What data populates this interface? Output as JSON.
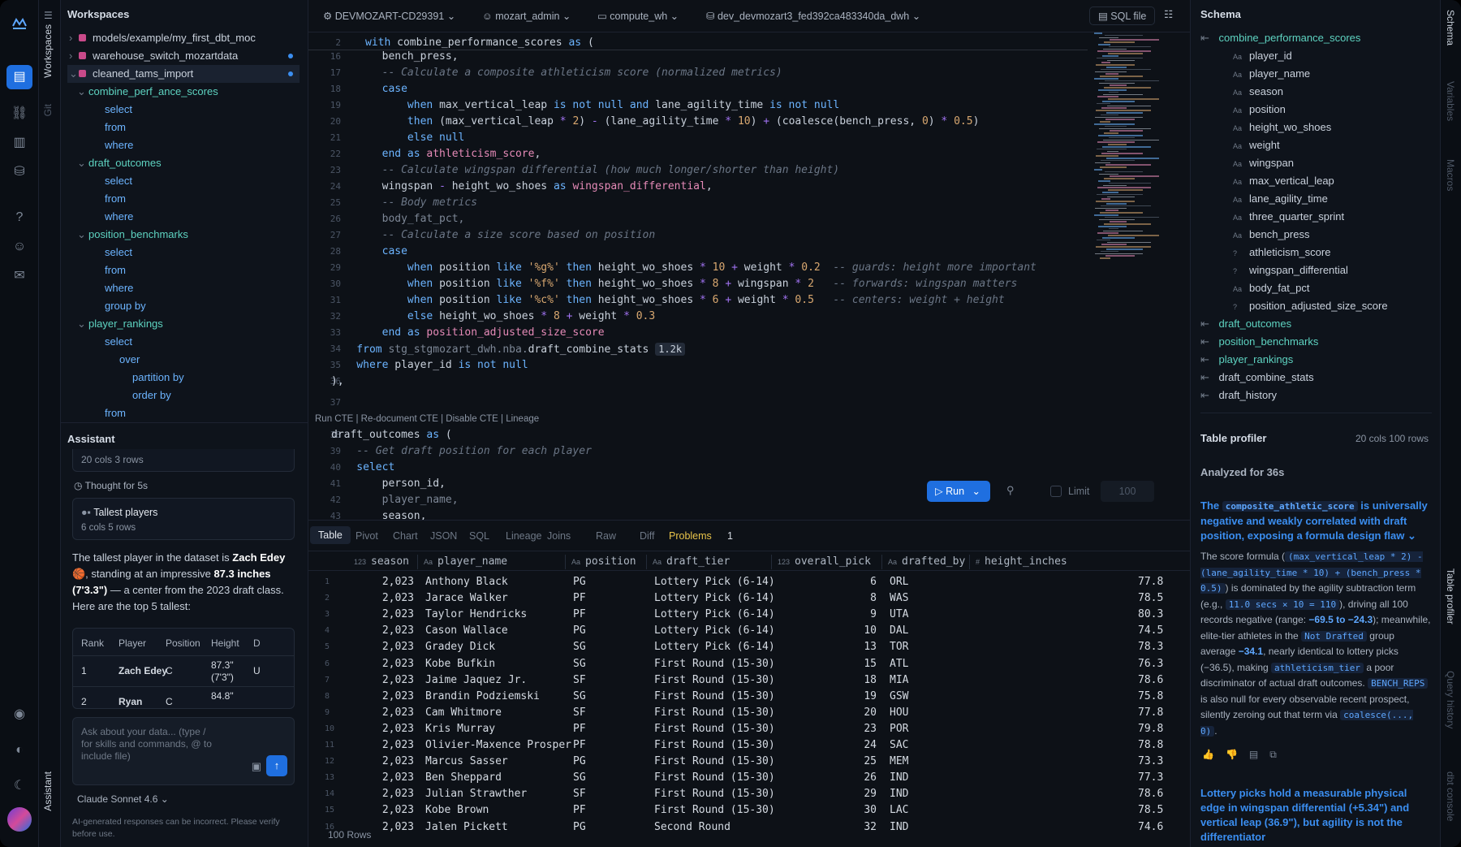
{
  "workspaces": {
    "title": "Workspaces",
    "files": [
      {
        "name": "models/example/my_first_dbt_moc",
        "dot": false
      },
      {
        "name": "warehouse_switch_mozartdata",
        "dot": true
      },
      {
        "name": "cleaned_tams_import",
        "dot": true
      }
    ],
    "outline": [
      {
        "label": "combine_perf_ance_scores",
        "kind": "cte",
        "indent": 0
      },
      {
        "label": "select",
        "kind": "kw",
        "indent": 1
      },
      {
        "label": "from",
        "kind": "kw",
        "indent": 1
      },
      {
        "label": "where",
        "kind": "kw",
        "indent": 1
      },
      {
        "label": "draft_outcomes",
        "kind": "cte",
        "indent": 0
      },
      {
        "label": "select",
        "kind": "kw",
        "indent": 1
      },
      {
        "label": "from",
        "kind": "kw",
        "indent": 1
      },
      {
        "label": "where",
        "kind": "kw",
        "indent": 1
      },
      {
        "label": "position_benchmarks",
        "kind": "cte",
        "indent": 0
      },
      {
        "label": "select",
        "kind": "kw",
        "indent": 1
      },
      {
        "label": "from",
        "kind": "kw",
        "indent": 1
      },
      {
        "label": "where",
        "kind": "kw",
        "indent": 1
      },
      {
        "label": "group by",
        "kind": "kw",
        "indent": 1
      },
      {
        "label": "player_rankings",
        "kind": "cte",
        "indent": 0
      },
      {
        "label": "select",
        "kind": "kw",
        "indent": 1
      },
      {
        "label": "over",
        "kind": "kw",
        "indent": 2
      },
      {
        "label": "partition by",
        "kind": "kw",
        "indent": 3
      },
      {
        "label": "order by",
        "kind": "kw",
        "indent": 3
      },
      {
        "label": "from",
        "kind": "kw",
        "indent": 1
      }
    ]
  },
  "strip": {
    "workspaces": "Workspaces",
    "git": "Git",
    "assistant": "Assistant"
  },
  "assistant": {
    "title": "Assistant",
    "prev_meta": "20 cols 3 rows",
    "thought": "Thought for 5s",
    "result_title": "Tallest players",
    "result_meta": "6 cols 5 rows",
    "msg_1": "The tallest player in the dataset is ",
    "msg_name": "Zach Edey",
    "msg_2": " 🏀, standing at an impressive ",
    "msg_height": "87.3 inches (7'3.3\")",
    "msg_3": " — a center from the 2023 draft class. Here are the top 5 tallest:",
    "table_headers": [
      "Rank",
      "Player",
      "Position",
      "Height",
      "D"
    ],
    "table_rows": [
      [
        "1",
        "Zach Edey",
        "C",
        "87.3\" (7'3\")",
        "U"
      ],
      [
        "2",
        "Ryan",
        "C",
        "84.8\"",
        ""
      ]
    ],
    "input_placeholder": "Ask about your data... (type / for skills and commands, @ to include file)",
    "model": "Claude Sonnet 4.6",
    "disclaimer": "AI-generated responses can be incorrect. Please verify before use."
  },
  "topbar": {
    "account": "DEVMOZART-CD29391",
    "user": "mozart_admin",
    "warehouse": "compute_wh",
    "database": "dev_devmozart3_fed392ca483340da_dwh",
    "sql_file": "SQL file"
  },
  "code_lines": [
    {
      "n": "2",
      "t": [
        [
          "k",
          "with "
        ],
        [
          "x",
          "combine_performance_scores "
        ],
        [
          "k",
          "as"
        ],
        [
          "x",
          " ("
        ]
      ]
    },
    {
      "n": "16",
      "t": [
        [
          "x",
          "        bench_press,"
        ]
      ]
    },
    {
      "n": "17",
      "t": [
        [
          "c",
          "        -- Calculate a composite athleticism score (normalized metrics)"
        ]
      ]
    },
    {
      "n": "18",
      "t": [
        [
          "k",
          "        case"
        ]
      ]
    },
    {
      "n": "19",
      "t": [
        [
          "k",
          "            when "
        ],
        [
          "x",
          "max_vertical_leap "
        ],
        [
          "k",
          "is not null and "
        ],
        [
          "x",
          "lane_agility_time "
        ],
        [
          "k",
          "is not null"
        ]
      ]
    },
    {
      "n": "20",
      "t": [
        [
          "k",
          "            then "
        ],
        [
          "x",
          "(max_vertical_leap "
        ],
        [
          "o",
          "* "
        ],
        [
          "n",
          "2"
        ],
        [
          "x",
          ") "
        ],
        [
          "o",
          "- "
        ],
        [
          "x",
          "(lane_agility_time "
        ],
        [
          "o",
          "* "
        ],
        [
          "n",
          "10"
        ],
        [
          "x",
          ") "
        ],
        [
          "o",
          "+ "
        ],
        [
          "x",
          "(coalesce(bench_press, "
        ],
        [
          "n",
          "0"
        ],
        [
          "x",
          ") "
        ],
        [
          "o",
          "* "
        ],
        [
          "n",
          "0.5"
        ],
        [
          "x",
          ")"
        ]
      ]
    },
    {
      "n": "21",
      "t": [
        [
          "k",
          "            else null"
        ]
      ]
    },
    {
      "n": "22",
      "t": [
        [
          "k",
          "        end as "
        ],
        [
          "f",
          "athleticism_score"
        ],
        [
          "x",
          ","
        ]
      ]
    },
    {
      "n": "23",
      "t": [
        [
          "c",
          "        -- Calculate wingspan differential (how much longer/shorter than height)"
        ]
      ]
    },
    {
      "n": "24",
      "t": [
        [
          "x",
          "        wingspan "
        ],
        [
          "o",
          "- "
        ],
        [
          "x",
          "height_wo_shoes "
        ],
        [
          "k",
          "as "
        ],
        [
          "f",
          "wingspan_differential"
        ],
        [
          "x",
          ","
        ]
      ]
    },
    {
      "n": "25",
      "t": [
        [
          "c",
          "        -- Body metrics"
        ]
      ]
    },
    {
      "n": "26",
      "t": [
        [
          "g",
          "        body_fat_pct,"
        ]
      ]
    },
    {
      "n": "27",
      "t": [
        [
          "c",
          "        -- Calculate a size score based on position"
        ]
      ]
    },
    {
      "n": "28",
      "t": [
        [
          "k",
          "        case"
        ]
      ]
    },
    {
      "n": "29",
      "t": [
        [
          "k",
          "            when "
        ],
        [
          "x",
          "position "
        ],
        [
          "k",
          "like "
        ],
        [
          "s",
          "'%g%' "
        ],
        [
          "k",
          "then "
        ],
        [
          "x",
          "height_wo_shoes "
        ],
        [
          "o",
          "* "
        ],
        [
          "n",
          "10 "
        ],
        [
          "o",
          "+ "
        ],
        [
          "x",
          "weight "
        ],
        [
          "o",
          "* "
        ],
        [
          "n",
          "0.2"
        ],
        [
          "c",
          "  -- guards: height more important"
        ]
      ]
    },
    {
      "n": "30",
      "t": [
        [
          "k",
          "            when "
        ],
        [
          "x",
          "position "
        ],
        [
          "k",
          "like "
        ],
        [
          "s",
          "'%f%' "
        ],
        [
          "k",
          "then "
        ],
        [
          "x",
          "height_wo_shoes "
        ],
        [
          "o",
          "* "
        ],
        [
          "n",
          "8 "
        ],
        [
          "o",
          "+ "
        ],
        [
          "x",
          "wingspan "
        ],
        [
          "o",
          "* "
        ],
        [
          "n",
          "2"
        ],
        [
          "c",
          "   -- forwards: wingspan matters"
        ]
      ]
    },
    {
      "n": "31",
      "t": [
        [
          "k",
          "            when "
        ],
        [
          "x",
          "position "
        ],
        [
          "k",
          "like "
        ],
        [
          "s",
          "'%c%' "
        ],
        [
          "k",
          "then "
        ],
        [
          "x",
          "height_wo_shoes "
        ],
        [
          "o",
          "* "
        ],
        [
          "n",
          "6 "
        ],
        [
          "o",
          "+ "
        ],
        [
          "x",
          "weight "
        ],
        [
          "o",
          "* "
        ],
        [
          "n",
          "0.5"
        ],
        [
          "c",
          "   -- centers: weight + height"
        ]
      ]
    },
    {
      "n": "32",
      "t": [
        [
          "k",
          "            else "
        ],
        [
          "x",
          "height_wo_shoes "
        ],
        [
          "o",
          "* "
        ],
        [
          "n",
          "8 "
        ],
        [
          "o",
          "+ "
        ],
        [
          "x",
          "weight "
        ],
        [
          "o",
          "* "
        ],
        [
          "n",
          "0.3"
        ]
      ]
    },
    {
      "n": "33",
      "t": [
        [
          "k",
          "        end as "
        ],
        [
          "f",
          "position_adjusted_size_score"
        ]
      ]
    },
    {
      "n": "34",
      "t": [
        [
          "k",
          "    from "
        ],
        [
          "g",
          "stg_stgmozart_dwh.nba."
        ],
        [
          "x",
          "draft_combine_stats "
        ],
        [
          "b",
          "1.2k"
        ]
      ]
    },
    {
      "n": "35",
      "t": [
        [
          "k",
          "    where "
        ],
        [
          "x",
          "player_id "
        ],
        [
          "k",
          "is not null"
        ]
      ]
    },
    {
      "n": "36",
      "t": [
        [
          "x",
          "),"
        ]
      ]
    },
    {
      "n": "37",
      "t": [
        [
          "x",
          ""
        ]
      ]
    },
    {
      "n": "",
      "t": [
        [
          "h",
          "Run CTE | Re-document CTE | Disable CTE | Lineage"
        ]
      ]
    },
    {
      "n": "38",
      "t": [
        [
          "x",
          "draft_outcomes "
        ],
        [
          "k",
          "as "
        ],
        [
          "x",
          "("
        ]
      ]
    },
    {
      "n": "39",
      "t": [
        [
          "c",
          "    -- Get draft position for each player"
        ]
      ]
    },
    {
      "n": "40",
      "t": [
        [
          "k",
          "    select"
        ]
      ]
    },
    {
      "n": "41",
      "t": [
        [
          "x",
          "        person_id,"
        ]
      ]
    },
    {
      "n": "42",
      "t": [
        [
          "g",
          "        player_name,"
        ]
      ]
    },
    {
      "n": "43",
      "t": [
        [
          "x",
          "        season,"
        ]
      ]
    }
  ],
  "run": {
    "label": "Run",
    "limit_label": "Limit",
    "limit_value": "100"
  },
  "results": {
    "tabs": [
      "Table",
      "Pivot",
      "Chart",
      "JSON",
      "SQL",
      "Lineage",
      "Joins",
      "Raw",
      "Diff"
    ],
    "problems_label": "Problems",
    "problems_count": "1",
    "columns": [
      {
        "type": "123",
        "name": "season"
      },
      {
        "type": "Aa",
        "name": "player_name"
      },
      {
        "type": "Aa",
        "name": "position"
      },
      {
        "type": "Aa",
        "name": "draft_tier"
      },
      {
        "type": "123",
        "name": "overall_pick"
      },
      {
        "type": "Aa",
        "name": "drafted_by"
      },
      {
        "type": "#",
        "name": "height_inches"
      }
    ],
    "rows": [
      [
        "2,023",
        "Anthony Black",
        "PG",
        "Lottery Pick (6-14)",
        "6",
        "ORL",
        "77.8"
      ],
      [
        "2,023",
        "Jarace Walker",
        "PF",
        "Lottery Pick (6-14)",
        "8",
        "WAS",
        "78.5"
      ],
      [
        "2,023",
        "Taylor Hendricks",
        "PF",
        "Lottery Pick (6-14)",
        "9",
        "UTA",
        "80.3"
      ],
      [
        "2,023",
        "Cason Wallace",
        "PG",
        "Lottery Pick (6-14)",
        "10",
        "DAL",
        "74.5"
      ],
      [
        "2,023",
        "Gradey Dick",
        "SG",
        "Lottery Pick (6-14)",
        "13",
        "TOR",
        "78.3"
      ],
      [
        "2,023",
        "Kobe Bufkin",
        "SG",
        "First Round (15-30)",
        "15",
        "ATL",
        "76.3"
      ],
      [
        "2,023",
        "Jaime Jaquez Jr.",
        "SF",
        "First Round (15-30)",
        "18",
        "MIA",
        "78.6"
      ],
      [
        "2,023",
        "Brandin Podziemski",
        "SG",
        "First Round (15-30)",
        "19",
        "GSW",
        "75.8"
      ],
      [
        "2,023",
        "Cam Whitmore",
        "SF",
        "First Round (15-30)",
        "20",
        "HOU",
        "77.8"
      ],
      [
        "2,023",
        "Kris Murray",
        "PF",
        "First Round (15-30)",
        "23",
        "POR",
        "79.8"
      ],
      [
        "2,023",
        "Olivier-Maxence Prosper",
        "PF",
        "First Round (15-30)",
        "24",
        "SAC",
        "78.8"
      ],
      [
        "2,023",
        "Marcus Sasser",
        "PG",
        "First Round (15-30)",
        "25",
        "MEM",
        "73.3"
      ],
      [
        "2,023",
        "Ben Sheppard",
        "SG",
        "First Round (15-30)",
        "26",
        "IND",
        "77.3"
      ],
      [
        "2,023",
        "Julian Strawther",
        "SF",
        "First Round (15-30)",
        "29",
        "IND",
        "78.6"
      ],
      [
        "2,023",
        "Kobe Brown",
        "PF",
        "First Round (15-30)",
        "30",
        "LAC",
        "78.5"
      ],
      [
        "2,023",
        "Jalen Pickett",
        "PG",
        "Second Round",
        "32",
        "IND",
        "74.6"
      ]
    ],
    "row_count": "100 Rows"
  },
  "schema": {
    "title": "Schema",
    "table": "combine_performance_scores",
    "columns": [
      {
        "t": "Aa",
        "n": "player_id"
      },
      {
        "t": "Aa",
        "n": "player_name"
      },
      {
        "t": "Aa",
        "n": "season"
      },
      {
        "t": "Aa",
        "n": "position"
      },
      {
        "t": "Aa",
        "n": "height_wo_shoes"
      },
      {
        "t": "Aa",
        "n": "weight"
      },
      {
        "t": "Aa",
        "n": "wingspan"
      },
      {
        "t": "Aa",
        "n": "max_vertical_leap"
      },
      {
        "t": "Aa",
        "n": "lane_agility_time"
      },
      {
        "t": "Aa",
        "n": "three_quarter_sprint"
      },
      {
        "t": "Aa",
        "n": "bench_press"
      },
      {
        "t": "?",
        "n": "athleticism_score"
      },
      {
        "t": "?",
        "n": "wingspan_differential"
      },
      {
        "t": "Aa",
        "n": "body_fat_pct"
      },
      {
        "t": "?",
        "n": "position_adjusted_size_score"
      }
    ],
    "tables": [
      {
        "n": "draft_outcomes",
        "cte": true
      },
      {
        "n": "position_benchmarks",
        "cte": true
      },
      {
        "n": "player_rankings",
        "cte": true
      },
      {
        "n": "draft_combine_stats",
        "cte": false
      },
      {
        "n": "draft_history",
        "cte": false
      }
    ]
  },
  "profiler": {
    "title": "Table profiler",
    "meta": "20 cols 100 rows",
    "analyzed": "Analyzed for 36s",
    "h1_a": "The ",
    "h1_code": "composite_athletic_score",
    "h1_b": " is universally negative and weakly correlated with draft position, exposing a formula design flaw",
    "p_a": "The score formula (",
    "p_code1": "(max_vertical_leap * 2) - (lane_agility_time * 10) + (bench_press * 0.5)",
    "p_b": ") is dominated by the agility subtraction term (e.g., ",
    "p_code2": "11.0 secs × 10 = 110",
    "p_c": "), driving all 100 records negative (range: ",
    "p_range": "−69.5 to −24.3",
    "p_d": "); meanwhile, elite-tier athletes in the ",
    "p_code3": "Not Drafted",
    "p_e": " group average ",
    "p_avg": "−34.1",
    "p_f": ", nearly identical to lottery picks (−36.5), making ",
    "p_code4": "athleticism_tier",
    "p_g": " a poor discriminator of actual draft outcomes. ",
    "p_code5": "BENCH_REPS",
    "p_h": " is also null for every observable recent prospect, silently zeroing out that term via ",
    "p_code6": "coalesce(..., 0)",
    "p_i": ".",
    "h2": "Lottery picks hold a measurable physical edge in wingspan differential (+5.34\") and vertical leap (36.9\"), but agility is not the differentiator"
  },
  "far_rail": {
    "schema": "Schema",
    "variables": "Variables",
    "macros": "Macros",
    "profiler": "Table profiler",
    "history": "Query history",
    "console": "dbt console"
  },
  "colors": {
    "accent": "#3b8ef0",
    "cte": "#5ed3c1",
    "keyword": "#6cb4ff",
    "problems": "#e8c34a"
  }
}
